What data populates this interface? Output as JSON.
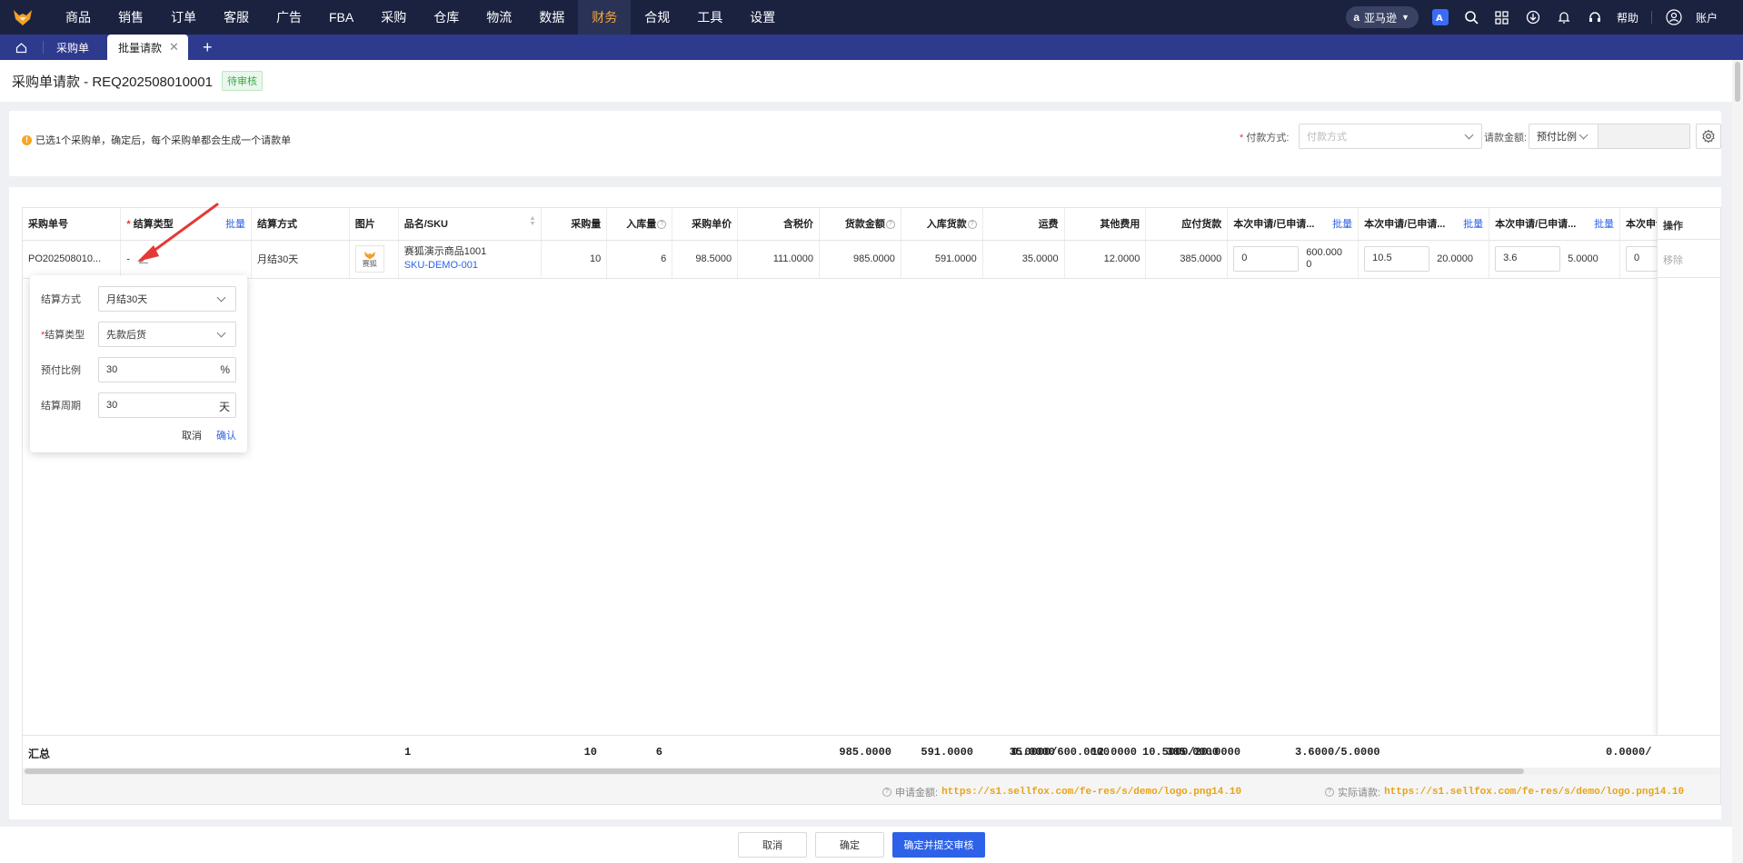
{
  "nav": {
    "menu": [
      "商品",
      "销售",
      "订单",
      "客服",
      "广告",
      "FBA",
      "采购",
      "仓库",
      "物流",
      "数据",
      "财务",
      "合规",
      "工具",
      "设置"
    ],
    "active_menu": "财务",
    "region": "亚马逊",
    "help": "帮助",
    "account": "账户"
  },
  "tabs": {
    "items": [
      "采购单",
      "批量请款"
    ],
    "active": "批量请款",
    "add": "+"
  },
  "header": {
    "title": "采购单请款 - REQ202508010001",
    "status": "待审核"
  },
  "info": {
    "notice": "已选1个采购单，确定后，每个采购单都会生成一个请款单",
    "pay_method_label": "付款方式:",
    "pay_method_placeholder": "付款方式",
    "amount_label": "请款金额:",
    "amount_mode": "预付比例",
    "amount_value": ""
  },
  "table": {
    "columns": [
      "采购单号",
      "结算类型",
      "结算方式",
      "图片",
      "品名/SKU",
      "采购量",
      "入库量",
      "采购单价",
      "含税价",
      "货款金额",
      "入库货款",
      "运费",
      "其他费用",
      "应付货款",
      "本次申请/已申请...",
      "本次申请/已申请...",
      "本次申请/已申请...",
      "本次申请/已",
      "操作"
    ],
    "batch_label": "批量",
    "row": {
      "po": "PO202508010...",
      "settle_type": "-",
      "settle_method": "月结30天",
      "img_text": "赛狐",
      "name": "赛狐演示商品1001",
      "sku": "SKU-DEMO-001",
      "qty": "10",
      "in_qty": "6",
      "unit_price": "98.5000",
      "tax_price": "111.0000",
      "amount": "985.0000",
      "in_amount": "591.0000",
      "freight": "35.0000",
      "other": "12.0000",
      "payable": "385.0000",
      "apply1_input": "0",
      "apply1_right": "600.000\n0",
      "apply1_right_a": "600.000",
      "apply1_right_b": "0",
      "apply2_input": "10.5",
      "apply2_right": "20.0000",
      "apply3_input": "3.6",
      "apply3_right": "5.0000",
      "apply4_input": "0",
      "remove": "移除"
    },
    "summary": {
      "label": "汇总",
      "count": "1",
      "qty": "10",
      "in_qty": "6",
      "amount": "985.0000",
      "in_amount": "591.0000",
      "freight": "35.0000",
      "other": "12.0000",
      "payable": "385.0000",
      "apply1": "0.0000/600.0000",
      "apply2": "10.5000/20.0000",
      "apply3": "3.6000/5.0000",
      "apply4": "0.0000/"
    },
    "footer": {
      "apply_label": "申请金额:",
      "apply_value": "https://s1.sellfox.com/fe-res/s/demo/logo.png14.10",
      "actual_label": "实际请款:",
      "actual_value": "https://s1.sellfox.com/fe-res/s/demo/logo.png14.10"
    }
  },
  "popover": {
    "method_label": "结算方式",
    "method_value": "月结30天",
    "type_label": "结算类型",
    "type_value": "先款后货",
    "ratio_label": "预付比例",
    "ratio_value": "30",
    "ratio_unit": "%",
    "period_label": "结算周期",
    "period_value": "30",
    "period_unit": "天",
    "cancel": "取消",
    "confirm": "确认"
  },
  "actions": {
    "cancel": "取消",
    "ok": "确定",
    "submit": "确定并提交审核"
  },
  "colors": {
    "nav_bg": "#1b2240",
    "tab_bg": "#2d3a8e",
    "accent": "#2d62e8",
    "active_menu": "#f7a93a",
    "amount_highlight": "#e8a317"
  }
}
